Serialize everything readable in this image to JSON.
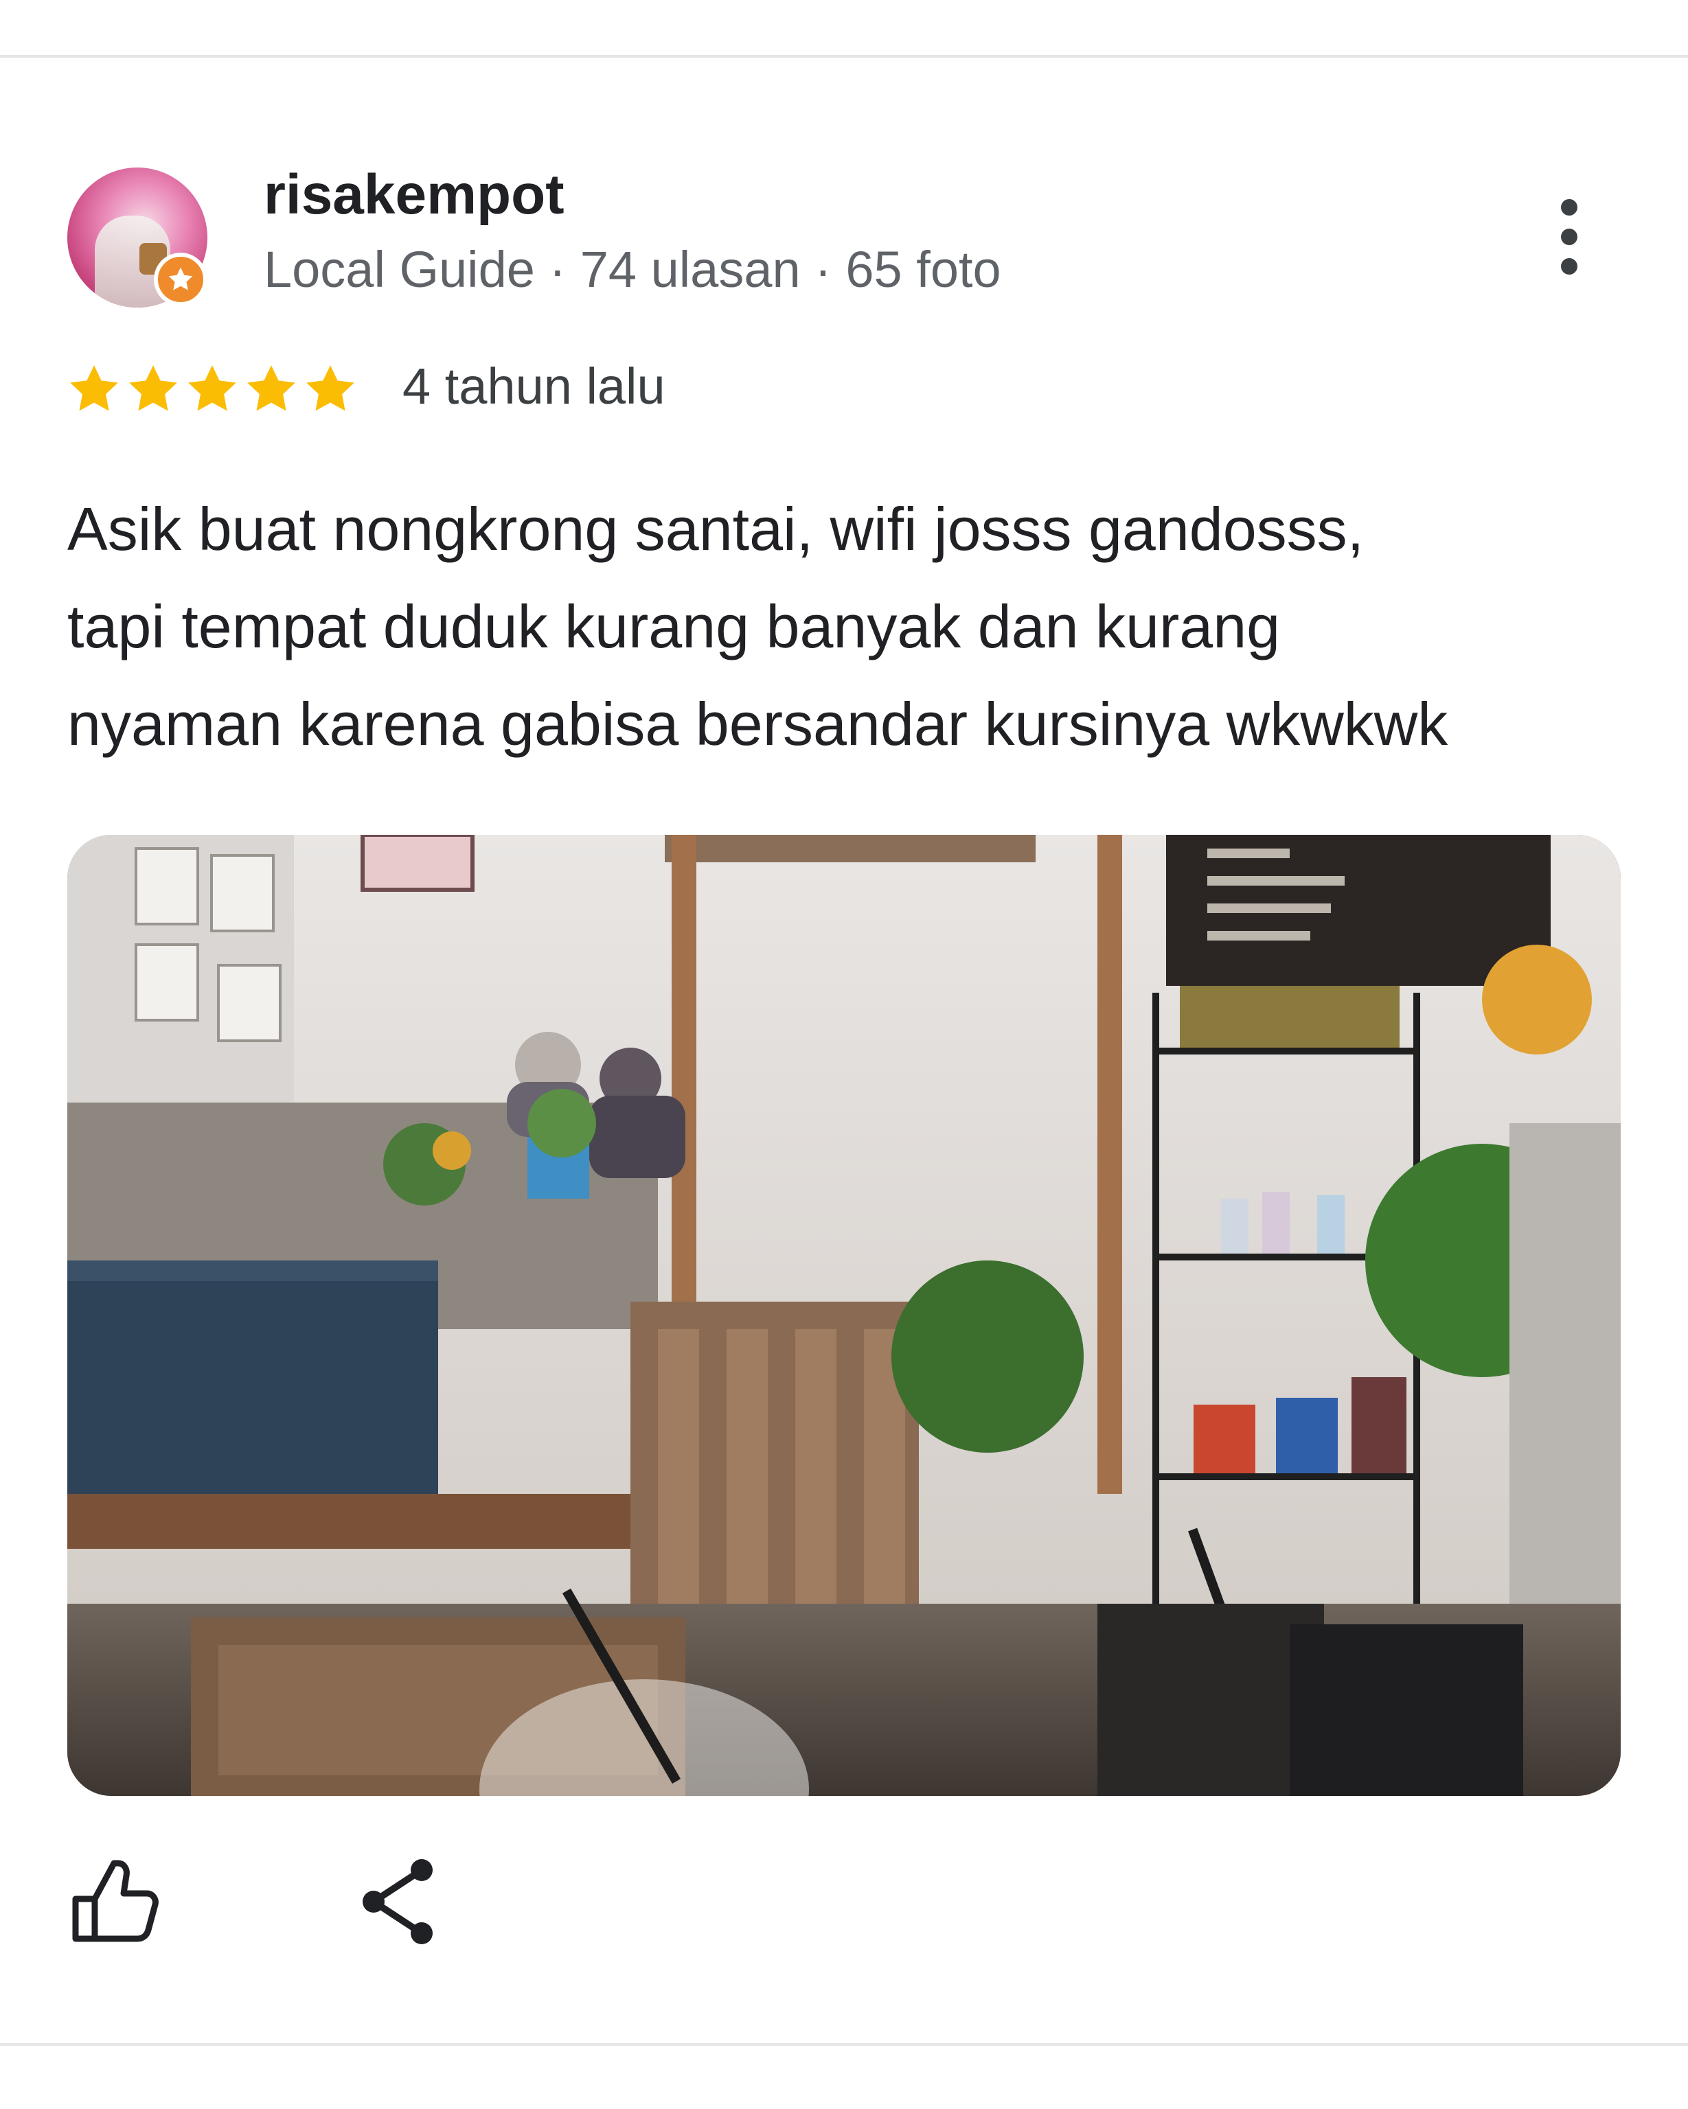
{
  "review": {
    "author": {
      "name": "risakempot",
      "meta": "Local Guide · 74 ulasan · 65 foto",
      "avatar_icon": "profile-photo",
      "badge_icon": "local-guide-star-badge",
      "badge_color": "#f08b2b"
    },
    "rating": {
      "stars": 5,
      "max": 5,
      "star_color": "#fbbc04"
    },
    "date": "4 tahun lalu",
    "text_lines": [
      "Asik buat nongkrong santai, wifi josss gandosss,",
      "tapi tempat duduk kurang banyak dan kurang",
      "nyaman karena gabisa bersandar kursinya wkwkwk"
    ],
    "actions": {
      "more_icon": "more-vert-icon",
      "like_icon": "thumbs-up-icon",
      "share_icon": "share-icon"
    }
  }
}
